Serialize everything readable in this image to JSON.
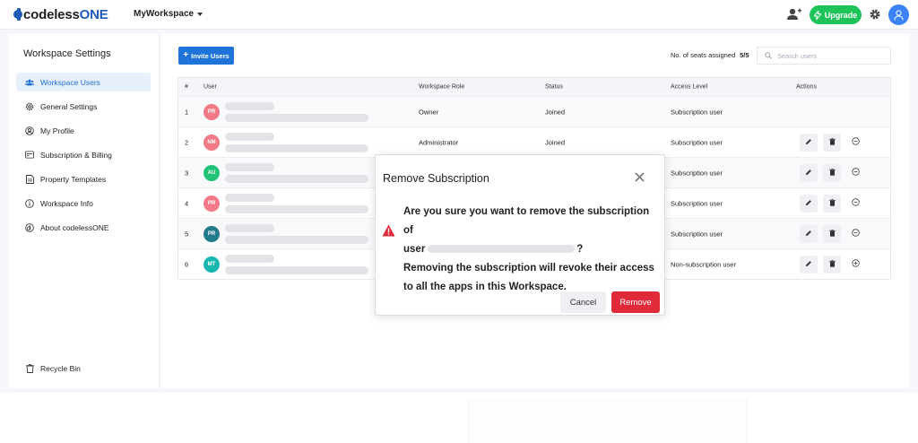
{
  "app": {
    "logo_lc": "codeless",
    "logo_uc": "ONE",
    "workspace_name": "MyWorkspace",
    "upgrade_label": "Upgrade"
  },
  "sidebar": {
    "title": "Workspace Settings",
    "items": [
      {
        "label": "Workspace Users",
        "icon": "users-icon",
        "active": true
      },
      {
        "label": "General Settings",
        "icon": "gear-icon",
        "active": false
      },
      {
        "label": "My Profile",
        "icon": "user-circle-icon",
        "active": false
      },
      {
        "label": "Subscription & Billing",
        "icon": "credit-card-icon",
        "active": false
      },
      {
        "label": "Property Templates",
        "icon": "document-icon",
        "active": false
      },
      {
        "label": "Workspace Info",
        "icon": "info-icon",
        "active": false
      },
      {
        "label": "About codelessONE",
        "icon": "logo-icon",
        "active": false
      }
    ],
    "recycle_bin": "Recycle Bin"
  },
  "main": {
    "invite_label": "Invite Users",
    "seats_label": "No. of seats assigned",
    "seats_value": "5/5",
    "search_placeholder": "Search users"
  },
  "table": {
    "headers": [
      "#",
      "User",
      "Workspace Role",
      "Status",
      "Access Level",
      "Actions"
    ],
    "rows": [
      {
        "num": "1",
        "initials": "PR",
        "avatar_color": "#f17a86",
        "role": "Owner",
        "status": "Joined",
        "access": "Subscription user",
        "actions": false,
        "third_action": ""
      },
      {
        "num": "2",
        "initials": "NM",
        "avatar_color": "#f17a86",
        "role": "Administrator",
        "status": "Joined",
        "access": "Subscription user",
        "actions": true,
        "third_action": "minus"
      },
      {
        "num": "3",
        "initials": "AU",
        "avatar_color": "#24c277",
        "role": "",
        "status": "",
        "access": "Subscription user",
        "actions": true,
        "third_action": "minus"
      },
      {
        "num": "4",
        "initials": "PR",
        "avatar_color": "#f17a86",
        "role": "",
        "status": "",
        "access": "Subscription user",
        "actions": true,
        "third_action": "minus"
      },
      {
        "num": "5",
        "initials": "PR",
        "avatar_color": "#237b8a",
        "role": "",
        "status": "",
        "access": "Subscription user",
        "actions": true,
        "third_action": "minus"
      },
      {
        "num": "6",
        "initials": "MT",
        "avatar_color": "#18b7b0",
        "role": "",
        "status": "",
        "access": "Non-subscription user",
        "actions": true,
        "third_action": "plus"
      }
    ]
  },
  "modal": {
    "title": "Remove Subscription",
    "line1": "Are you sure you want to remove the subscription of",
    "line2_prefix": "user",
    "line2_suffix": "?",
    "line3": "Removing the subscription will revoke their access",
    "line4": "to all the apps in this Workspace.",
    "cancel_label": "Cancel",
    "remove_label": "Remove"
  },
  "colors": {
    "brand": "#1e5bb8",
    "primary": "#1e74d8",
    "upgrade": "#1ec35a",
    "danger": "#e02a3a"
  }
}
